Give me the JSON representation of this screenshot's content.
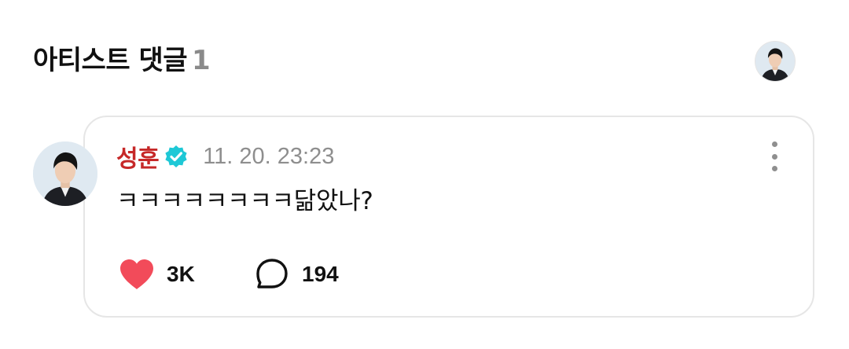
{
  "section": {
    "title": "아티스트 댓글",
    "count": "1"
  },
  "header_avatar": {
    "icon": "profile-avatar"
  },
  "comment": {
    "author": "성훈",
    "verified_icon": "verified-badge-icon",
    "verified_color": "#1ec8d6",
    "timestamp": "11. 20. 23:23",
    "text": "ㅋㅋㅋㅋㅋㅋㅋㅋ닮았나?",
    "likes": "3K",
    "replies": "194",
    "author_color": "#c62828",
    "like_color": "#f24b5a",
    "more_icon": "more-vertical-icon",
    "like_icon": "heart-icon",
    "reply_icon": "speech-bubble-icon"
  }
}
